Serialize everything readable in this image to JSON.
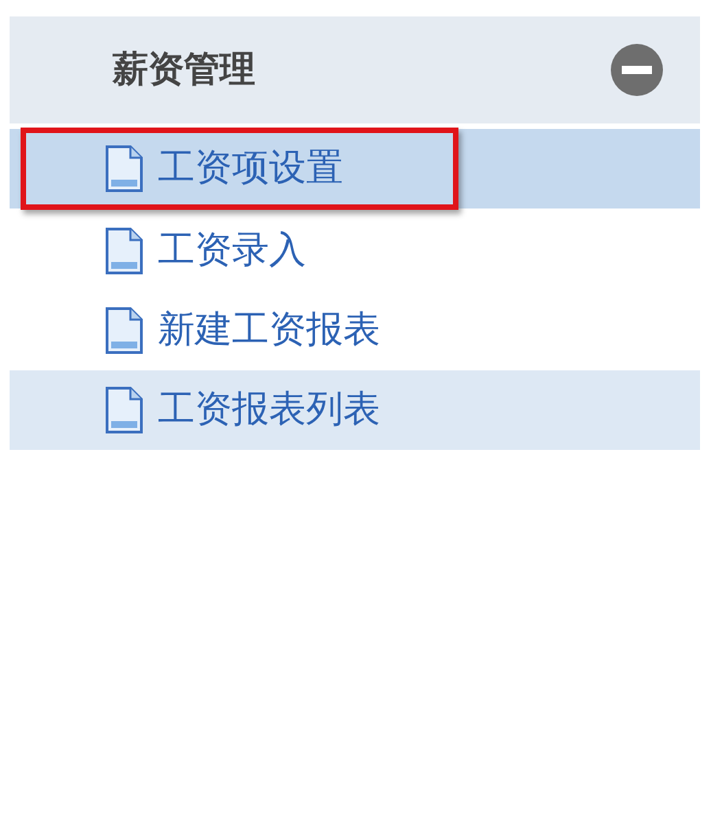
{
  "panel": {
    "title": "薪资管理",
    "expanded": true,
    "items": [
      {
        "label": "工资项设置",
        "selected": true,
        "highlighted": false
      },
      {
        "label": "工资录入",
        "selected": false,
        "highlighted": false
      },
      {
        "label": "新建工资报表",
        "selected": false,
        "highlighted": false
      },
      {
        "label": "工资报表列表",
        "selected": false,
        "highlighted": true
      }
    ]
  }
}
